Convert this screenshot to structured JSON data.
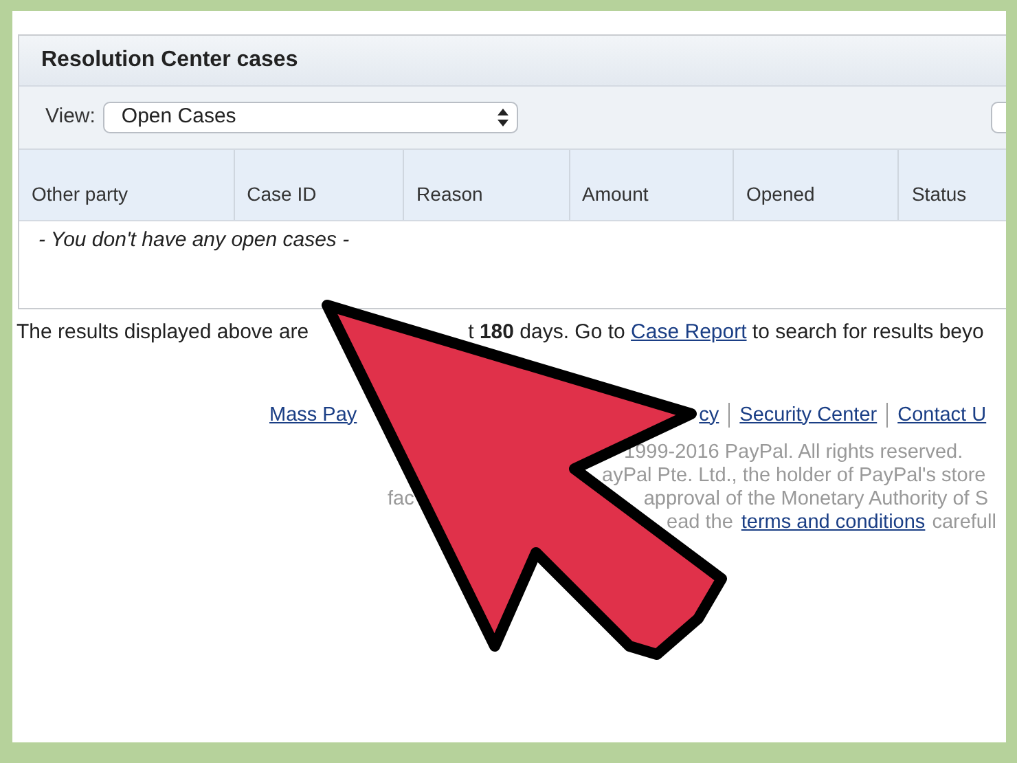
{
  "panel": {
    "title": "Resolution Center cases",
    "view": {
      "label": "View:",
      "value": "Open Cases"
    },
    "table": {
      "columns": [
        "Other party",
        "Case ID",
        "Reason",
        "Amount",
        "Opened",
        "Status"
      ],
      "empty_message": "- You don't have any open cases -"
    }
  },
  "notice": [
    {
      "text": "The results displayed above are"
    },
    {
      "text": "t **180** days. Go to ",
      "link": "Case Report",
      "after": " to search for results beyo"
    }
  ],
  "footer_links": [
    {
      "text": "Mass Pay",
      "separator_before": false
    },
    {
      "text": "cy",
      "separator_before": false
    },
    {
      "text": "Security Center",
      "separator_before": true
    },
    {
      "text": "Contact U",
      "separator_before": true
    }
  ],
  "copyright": [
    [
      {
        "text": "1999-2016 PayPal. All rights reserved.",
        "link": false
      }
    ],
    [
      {
        "text": "ayPal Pte. Ltd., the holder of PayPal's store",
        "link": false
      }
    ],
    [
      {
        "text": "fac",
        "link": false
      },
      {
        "text": "approval of the Monetary Authority of S",
        "link": false
      }
    ],
    [
      {
        "text": "ead the",
        "link": false
      },
      {
        "text": "terms and conditions",
        "link": true
      },
      {
        "text": "carefull",
        "link": false
      }
    ]
  ]
}
